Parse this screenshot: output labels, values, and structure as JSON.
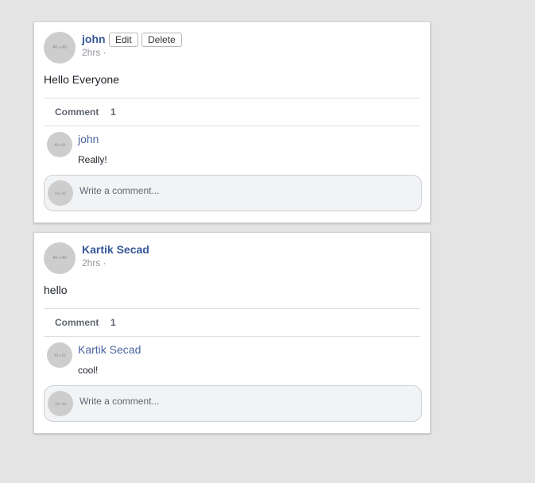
{
  "posts": [
    {
      "author": "john",
      "timestamp": "2hrs ·",
      "text": "Hello Everyone",
      "avatar_text": "40 x 40",
      "edit_label": "Edit",
      "delete_label": "Delete",
      "comment_label": "Comment",
      "comment_count": "1",
      "comments": [
        {
          "author": "john",
          "text": "Really!",
          "avatar_text": "40 x 40"
        }
      ],
      "comment_box": {
        "placeholder": "Write a comment...",
        "avatar_text": "40 x 40"
      }
    },
    {
      "author": "Kartik Secad",
      "timestamp": "2hrs ·",
      "text": "hello",
      "avatar_text": "40 x 40",
      "comment_label": "Comment",
      "comment_count": "1",
      "comments": [
        {
          "author": "Kartik Secad",
          "text": "cool!",
          "avatar_text": "40 x 40"
        }
      ],
      "comment_box": {
        "placeholder": "Write a comment...",
        "avatar_text": "40 x 40"
      }
    }
  ],
  "colors": {
    "background": "#e4e4e4",
    "author_link": "#365899",
    "comment_author_link": "#4a66a0",
    "muted_text": "#90949c",
    "avatar_placeholder": "#cdcdcd"
  }
}
